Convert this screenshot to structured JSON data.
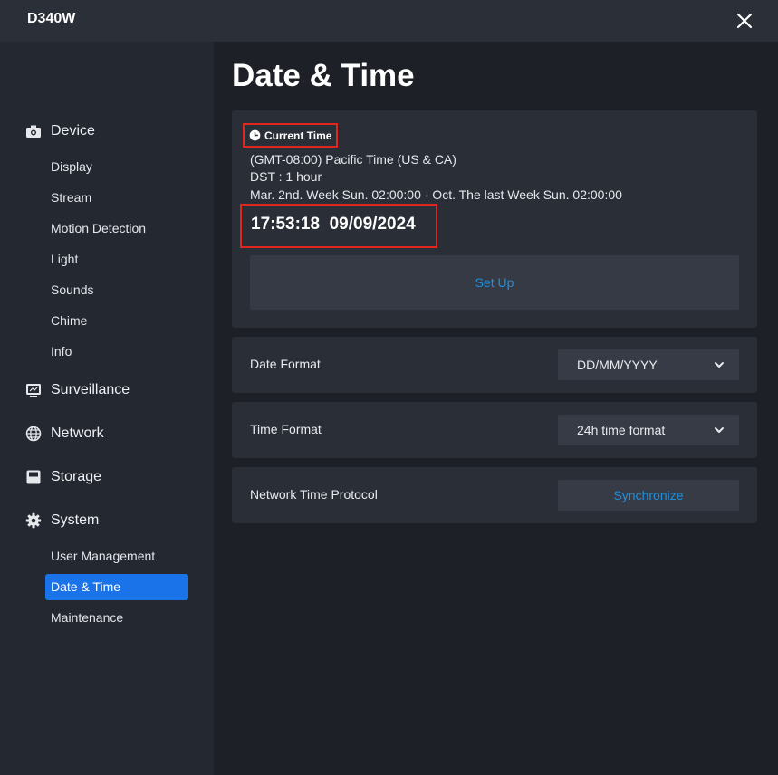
{
  "window": {
    "title": "D340W",
    "close_icon": "close-icon"
  },
  "sidebar": {
    "groups": [
      {
        "label": "Device",
        "icon": "camera-icon",
        "items": [
          "Display",
          "Stream",
          "Motion Detection",
          "Light",
          "Sounds",
          "Chime",
          "Info"
        ]
      },
      {
        "label": "Surveillance",
        "icon": "monitor-icon"
      },
      {
        "label": "Network",
        "icon": "globe-icon"
      },
      {
        "label": "Storage",
        "icon": "storage-icon"
      },
      {
        "label": "System",
        "icon": "gear-icon",
        "items": [
          "User Management",
          "Date & Time",
          "Maintenance"
        ]
      }
    ],
    "active_item": "Date & Time"
  },
  "main": {
    "title": "Date & Time",
    "current_time": {
      "label": "Current Time",
      "icon": "clock-icon",
      "timezone": "(GMT-08:00) Pacific Time (US & CA)",
      "dst": "DST : 1 hour",
      "dst_rule": "Mar. 2nd. Week Sun. 02:00:00 - Oct. The last Week Sun. 02:00:00",
      "clock": "17:53:18  09/09/2024",
      "setup_label": "Set Up"
    },
    "date_format": {
      "label": "Date Format",
      "value": "DD/MM/YYYY"
    },
    "time_format": {
      "label": "Time Format",
      "value": "24h time format"
    },
    "ntp": {
      "label": "Network Time Protocol",
      "button": "Synchronize"
    }
  },
  "colors": {
    "accent": "#1a73e8",
    "link": "#1e90e0",
    "highlight_box": "#e0261d"
  }
}
